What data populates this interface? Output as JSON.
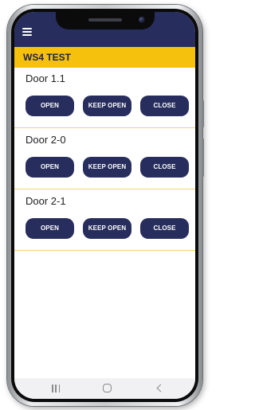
{
  "app": {
    "title": "WS4 TEST",
    "header_icon": "hamburger-menu-icon"
  },
  "doors": [
    {
      "name": "Door 1.1",
      "open_label": "OPEN",
      "keep_open_label": "KEEP OPEN",
      "close_label": "CLOSE"
    },
    {
      "name": "Door 2-0",
      "open_label": "OPEN",
      "keep_open_label": "KEEP OPEN",
      "close_label": "CLOSE"
    },
    {
      "name": "Door 2-1",
      "open_label": "OPEN",
      "keep_open_label": "KEEP OPEN",
      "close_label": "CLOSE"
    }
  ],
  "nav": {
    "icons": [
      "recents-icon",
      "home-icon",
      "back-icon"
    ]
  },
  "colors": {
    "header_navy": "#272d5c",
    "title_yellow": "#f6c10c",
    "button_navy": "#272d5c",
    "divider_yellow": "#f3d46a"
  }
}
